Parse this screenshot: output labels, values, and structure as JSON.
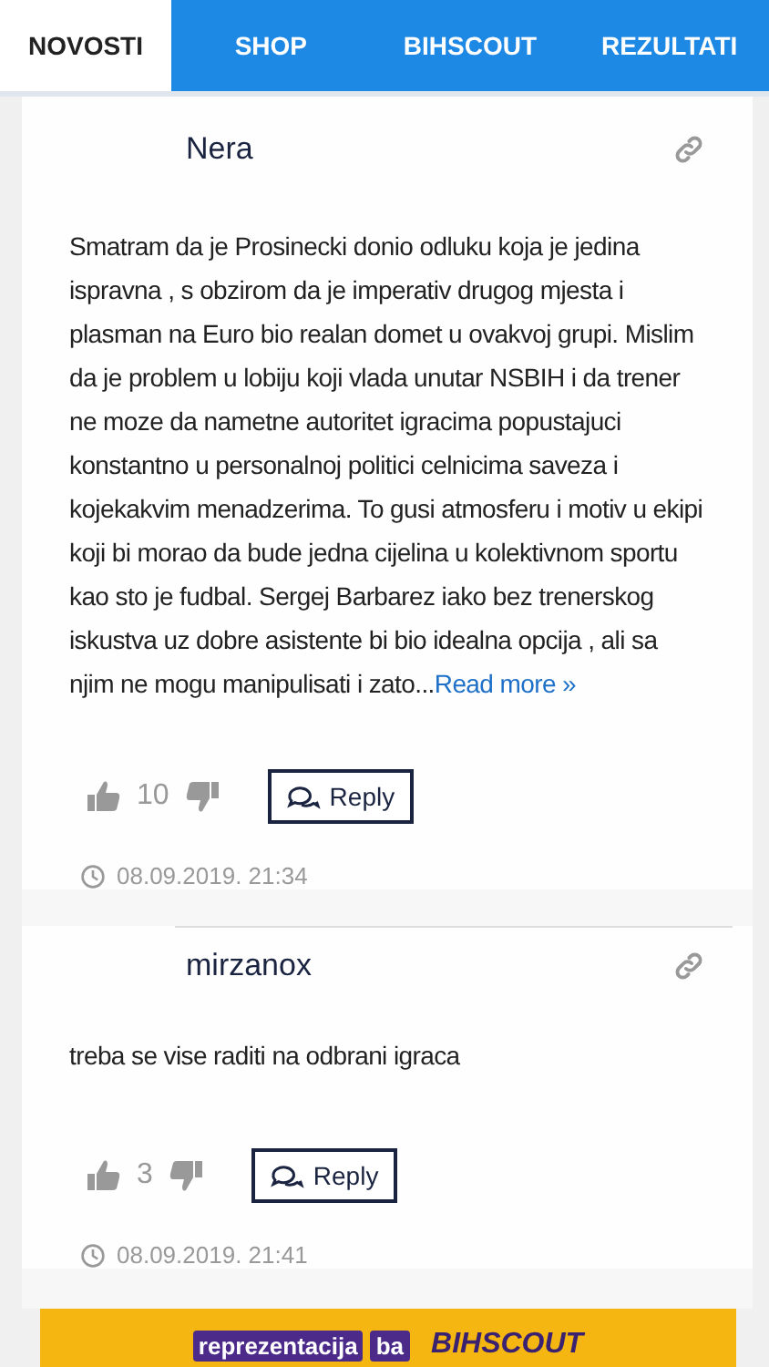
{
  "tabs": [
    {
      "label": "NOVOSTI",
      "selected": true
    },
    {
      "label": "SHOP",
      "selected": false
    },
    {
      "label": "BIHSCOUT",
      "selected": false
    },
    {
      "label": "REZULTATI",
      "selected": false
    }
  ],
  "comments": [
    {
      "author": "Nera",
      "text": "Smatram da je Prosinecki donio odluku koja je jedina ispravna , s obzirom da je imperativ drugog mjesta i plasman na Euro bio realan domet u ovakvoj grupi. Mislim da je problem u lobiju koji vlada unutar NSBIH i da trener ne moze da nametne autoritet igracima popustajuci konstantno u personalnoj politici celnicima saveza i kojekakvim menadzerima. To gusi atmosferu i motiv u ekipi koji bi morao da bude jedna cijelina u kolektivnom sportu kao sto je fudbal. Sergej Barbarez iako bez trenerskog iskustva uz dobre asistente bi bio idealna opcija , ali sa njim ne mogu manipulisati i zato...",
      "more": "Read more »",
      "likes": "10",
      "reply": "Reply",
      "date": "08.09.2019. 21:34",
      "divider": false
    },
    {
      "author": "mirzanox",
      "text": "treba se vise raditi na odbrani igraca",
      "likes": "3",
      "reply": "Reply",
      "date": "08.09.2019. 21:41",
      "divider": true
    }
  ],
  "banner": {
    "logo_main": "reprezentacija",
    "logo_suffix": "ba",
    "partner": "BIHSCOUT"
  }
}
